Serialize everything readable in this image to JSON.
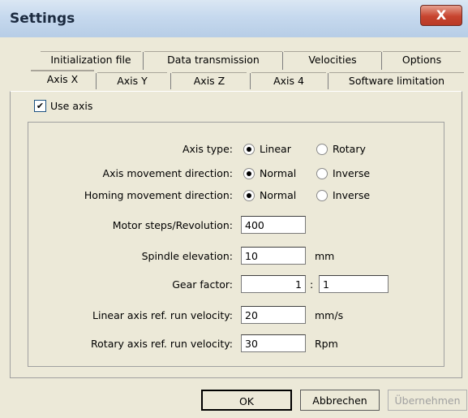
{
  "window": {
    "title": "Settings",
    "close_label": "X"
  },
  "tabs": {
    "row1": [
      "Initialization file",
      "Data transmission",
      "Velocities",
      "Options"
    ],
    "row2": [
      "Axis X",
      "Axis Y",
      "Axis Z",
      "Axis 4",
      "Software limitation"
    ],
    "active": "Axis X"
  },
  "use_axis": {
    "label": "Use axis",
    "checked": true,
    "mark": "✔"
  },
  "form": {
    "axis_type": {
      "label": "Axis type:",
      "opt1": "Linear",
      "opt2": "Rotary",
      "selected": "Linear"
    },
    "axis_direction": {
      "label": "Axis movement direction:",
      "opt1": "Normal",
      "opt2": "Inverse",
      "selected": "Normal"
    },
    "homing_direction": {
      "label": "Homing movement direction:",
      "opt1": "Normal",
      "opt2": "Inverse",
      "selected": "Normal"
    },
    "motor_steps": {
      "label": "Motor steps/Revolution:",
      "value": "400"
    },
    "spindle_elevation": {
      "label": "Spindle elevation:",
      "value": "10",
      "unit": "mm"
    },
    "gear_factor": {
      "label": "Gear factor:",
      "value1": "1",
      "separator": ":",
      "value2": "1"
    },
    "linear_velocity": {
      "label": "Linear axis ref. run velocity:",
      "value": "20",
      "unit": "mm/s"
    },
    "rotary_velocity": {
      "label": "Rotary axis ref. run velocity:",
      "value": "30",
      "unit": "Rpm"
    }
  },
  "buttons": {
    "ok": "OK",
    "cancel": "Abbrechen",
    "apply": "Übernehmen"
  }
}
